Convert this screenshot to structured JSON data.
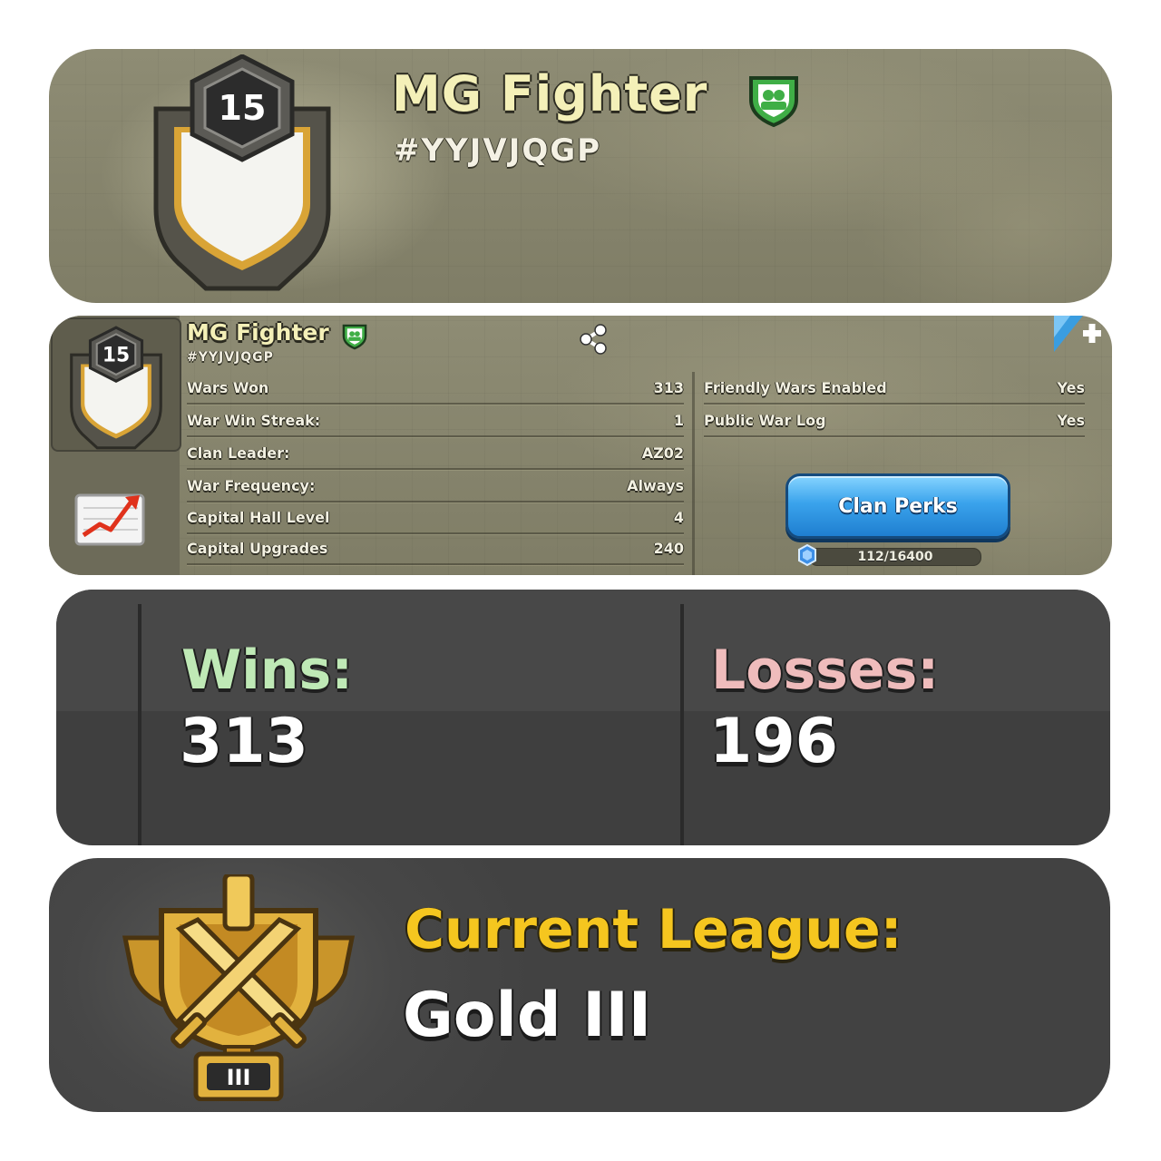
{
  "clan": {
    "name": "MG Fighter",
    "tag": "#YYJVJQGP",
    "level": "15"
  },
  "details": {
    "left_rows": [
      {
        "label": "Wars Won",
        "value": "313"
      },
      {
        "label": "War Win Streak:",
        "value": "1"
      },
      {
        "label": "Clan Leader:",
        "value": "AZ02"
      },
      {
        "label": "War Frequency:",
        "value": "Always"
      },
      {
        "label": "Capital Hall Level",
        "value": "4"
      },
      {
        "label": "Capital Upgrades",
        "value": "240"
      }
    ],
    "right_rows": [
      {
        "label": "Friendly Wars Enabled",
        "value": "Yes"
      },
      {
        "label": "Public War Log",
        "value": "Yes"
      }
    ],
    "perks_button": "Clan Perks",
    "xp_text": "112/16400",
    "xp_progress": 0.0068
  },
  "war_record": {
    "wins_label": "Wins:",
    "wins": "313",
    "losses_label": "Losses:",
    "losses": "196"
  },
  "league": {
    "label": "Current League:",
    "value": "Gold III",
    "badge_tier": "III"
  },
  "colors": {
    "wins_label": "#bfe9b6",
    "losses_label": "#efbcbc",
    "league_label": "#f5c61f",
    "button_blue": "#3aa3ec"
  },
  "icons": [
    "clan-badge-icon",
    "clan-members-shield-icon",
    "share-icon",
    "stats-chart-icon",
    "xp-gem-icon",
    "gold-league-trophy-icon",
    "corner-flag-icon"
  ]
}
